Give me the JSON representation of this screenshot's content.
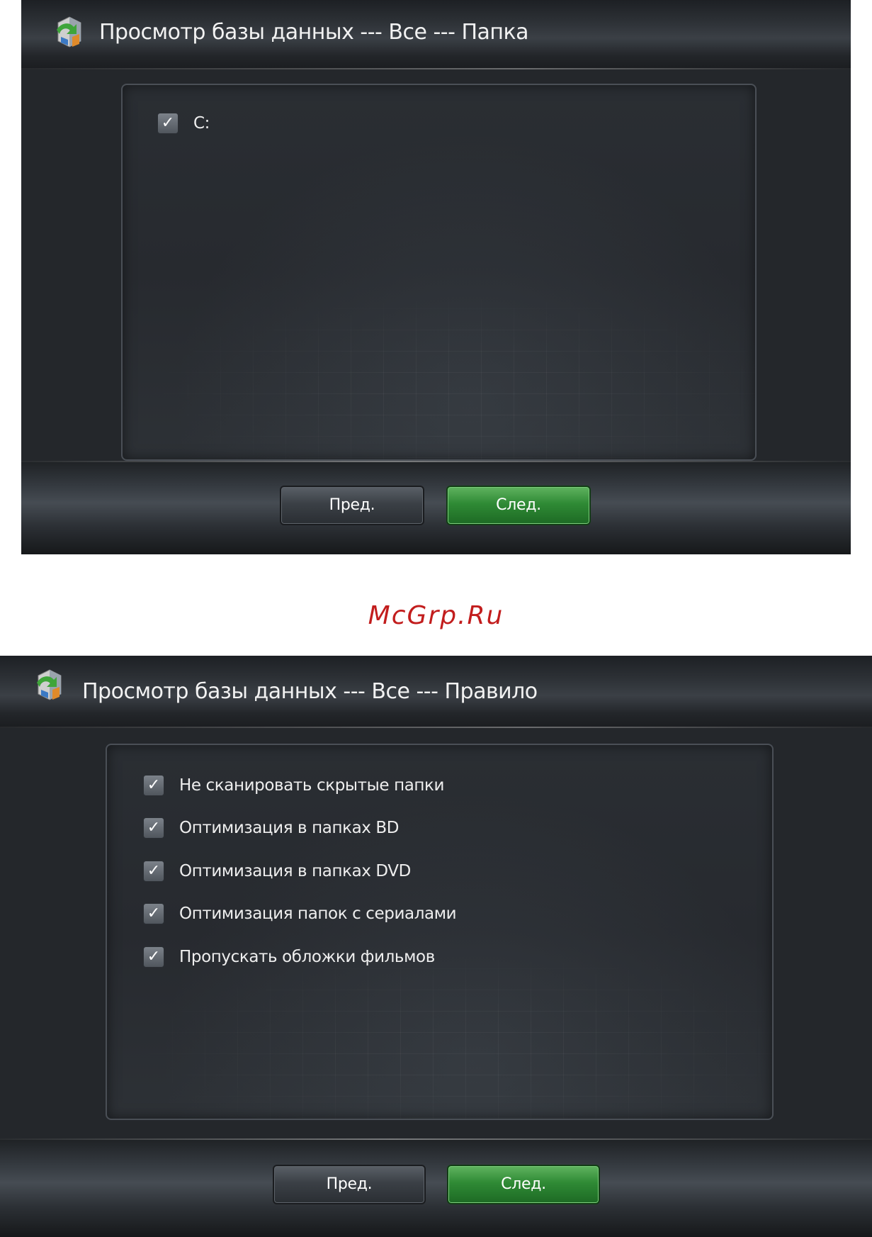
{
  "screen1": {
    "title": "Просмотр базы данных --- Все --- Папка",
    "items": [
      {
        "label": "C:",
        "checked": true
      }
    ],
    "prev_label": "Пред.",
    "next_label": "След."
  },
  "watermark": "McGrp.Ru",
  "screen2": {
    "title": "Просмотр базы данных --- Все --- Правило",
    "items": [
      {
        "label": "Не сканировать скрытые папки",
        "checked": true
      },
      {
        "label": "Оптимизация в папках BD",
        "checked": true
      },
      {
        "label": "Оптимизация в папках DVD",
        "checked": true
      },
      {
        "label": "Оптимизация папок с сериалами",
        "checked": true
      },
      {
        "label": "Пропускать обложки фильмов",
        "checked": true
      }
    ],
    "prev_label": "Пред.",
    "next_label": "След."
  },
  "icons": {
    "app": "media-library-icon",
    "check": "checkmark-icon"
  },
  "colors": {
    "next_button": "#2f8a35",
    "watermark": "#c21d1d"
  }
}
